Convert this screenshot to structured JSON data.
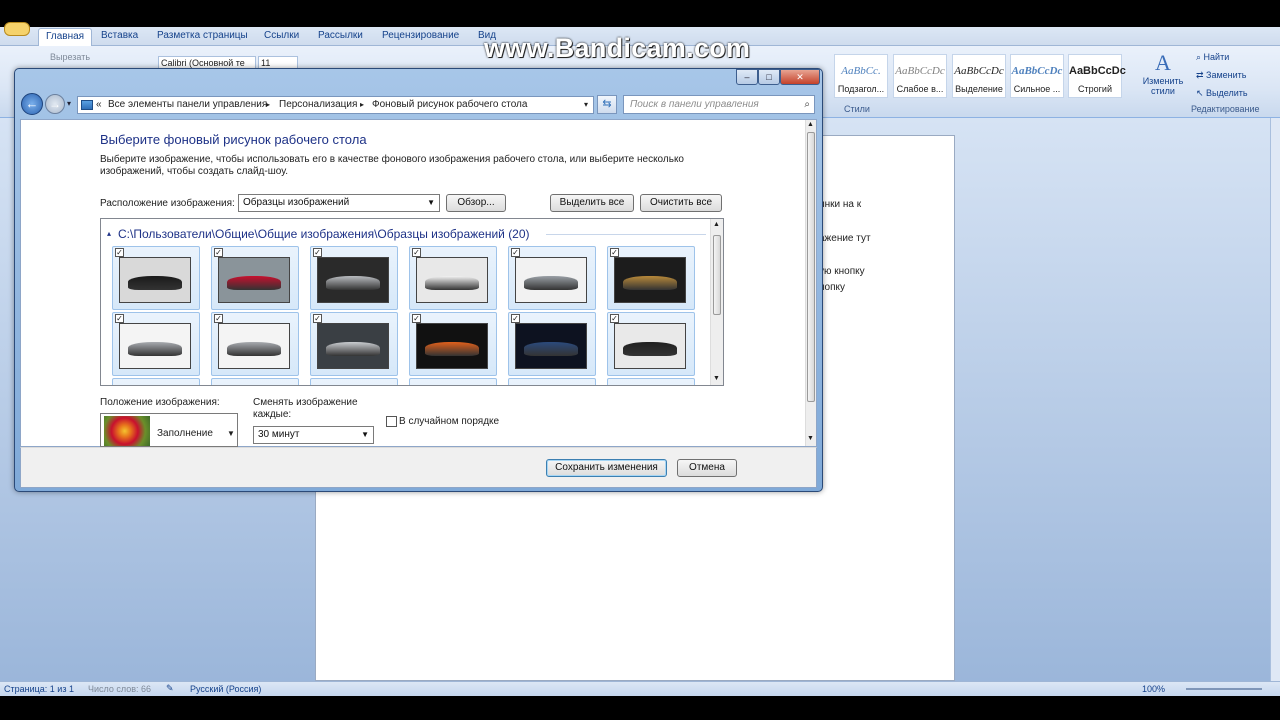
{
  "word": {
    "tabs": [
      "Главная",
      "Вставка",
      "Разметка страницы",
      "Ссылки",
      "Рассылки",
      "Рецензирование",
      "Вид"
    ],
    "cut_label": "Вырезать",
    "font_name": "Calibri (Основной те",
    "font_size": "11",
    "styles": [
      {
        "sample": "AaBbCc.",
        "name": "Подзагол..."
      },
      {
        "sample": "AaBbCcDc",
        "name": "Слабое в..."
      },
      {
        "sample": "AaBbCcDc",
        "name": "Выделение"
      },
      {
        "sample": "AaBbCcDc",
        "name": "Сильное ..."
      },
      {
        "sample": "AaBbCcDc",
        "name": "Строгий"
      }
    ],
    "change_styles": "Изменить стили",
    "styles_group": "Стили",
    "find": "Найти",
    "replace": "Заменить",
    "select": "Выделить",
    "editing_group": "Редактирование",
    "doc_fragments": [
      "инки на к",
      "ажение тут",
      "ую кнопку",
      "нопку"
    ],
    "status": {
      "page": "Страница: 1 из 1",
      "words": "Число слов: 66",
      "lang": "Русский (Россия)",
      "zoom": "100%"
    }
  },
  "watermark": "www.Bandicam.com",
  "dialog": {
    "address": {
      "items": [
        "Все элементы панели управления",
        "Персонализация",
        "Фоновый рисунок рабочего стола"
      ]
    },
    "search_placeholder": "Поиск в панели управления",
    "heading": "Выберите фоновый рисунок рабочего стола",
    "description_line1": "Выберите изображение, чтобы использовать его в качестве фонового изображения рабочего стола, или выберите несколько",
    "description_line2": "изображений, чтобы создать слайд-шоу.",
    "location_label": "Расположение изображения:",
    "location_value": "Образцы изображений",
    "browse_label": "Обзор...",
    "select_all_label": "Выделить все",
    "clear_all_label": "Очистить все",
    "gallery_path": "C:\\Пользователи\\Общие\\Общие изображения\\Образцы изображений (20)",
    "thumbnails": [
      {
        "checked": true,
        "bg": "#d9d9d9",
        "car": "#1a1a1a"
      },
      {
        "checked": true,
        "bg": "#8a949a",
        "car": "#c8102e"
      },
      {
        "checked": true,
        "bg": "#2a2a2a",
        "car": "#b9bcc0"
      },
      {
        "checked": true,
        "bg": "#e8e8e8",
        "car": "#f4f4f4"
      },
      {
        "checked": true,
        "bg": "#f2f2f2",
        "car": "#9aa0a6"
      },
      {
        "checked": true,
        "bg": "#1c1c1c",
        "car": "#b8893a"
      },
      {
        "checked": true,
        "bg": "#f4f4f4",
        "car": "#a8abb0"
      },
      {
        "checked": true,
        "bg": "#f4f4f4",
        "car": "#a8abb0"
      },
      {
        "checked": true,
        "bg": "#3a3f44",
        "car": "#c9ccd0"
      },
      {
        "checked": true,
        "bg": "#111111",
        "car": "#e0601b"
      },
      {
        "checked": true,
        "bg": "#0d1220",
        "car": "#2b4a7c"
      },
      {
        "checked": true,
        "bg": "#e9e9e9",
        "car": "#202020"
      }
    ],
    "position_label": "Положение изображения:",
    "position_value": "Заполнение",
    "interval_label_1": "Сменять изображение",
    "interval_label_2": "каждые:",
    "interval_value": "30 минут",
    "shuffle_label": "В случайном порядке",
    "save_label": "Сохранить изменения",
    "cancel_label": "Отмена"
  }
}
